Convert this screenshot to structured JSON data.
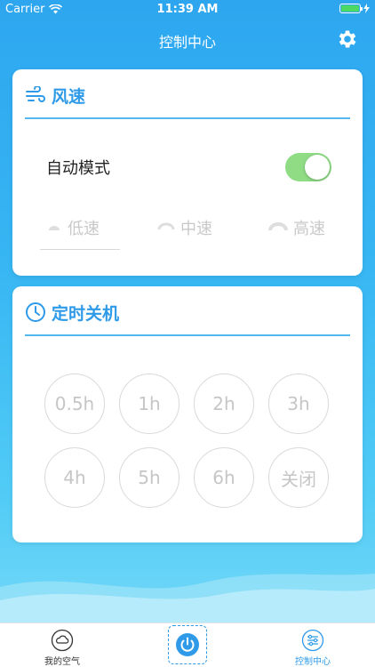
{
  "status": {
    "carrier": "Carrier",
    "time": "11:39 AM",
    "battery_level": 1.0
  },
  "nav": {
    "title": "控制中心"
  },
  "wind": {
    "title": "风速",
    "auto_mode_label": "自动模式",
    "auto_mode_on": true,
    "speeds": [
      "低速",
      "中速",
      "高速"
    ],
    "selected_speed": "低速"
  },
  "timer": {
    "title": "定时关机",
    "options": [
      "0.5h",
      "1h",
      "2h",
      "3h",
      "4h",
      "5h",
      "6h",
      "关闭"
    ]
  },
  "tabs": {
    "left": "我的空气",
    "right": "控制中心"
  },
  "colors": {
    "accent": "#2e9ae8",
    "toggle_on": "#8fdc85",
    "muted": "#c6c6c6"
  }
}
